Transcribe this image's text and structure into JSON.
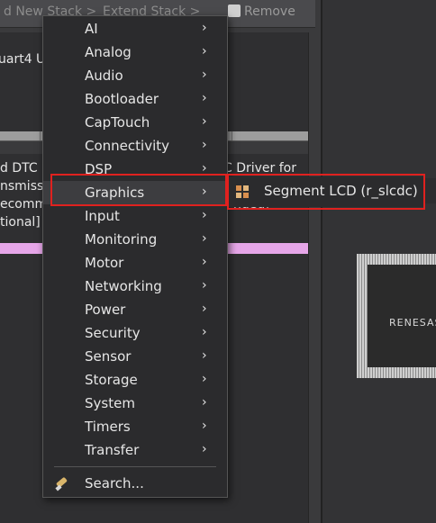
{
  "toolbar": {
    "new_stack": "d New Stack >",
    "extend_stack": "Extend Stack >",
    "remove": "Remove"
  },
  "panel": {
    "uart_label": "uart4 U",
    "lines": [
      "d DTC",
      "nsmiss",
      "ecomm",
      "tional]"
    ],
    "right_text_1": "C Driver for",
    "right_text_2": "nded)"
  },
  "menu": {
    "items": [
      {
        "label": "AI",
        "arrow": "›"
      },
      {
        "label": "Analog",
        "arrow": "›"
      },
      {
        "label": "Audio",
        "arrow": "›"
      },
      {
        "label": "Bootloader",
        "arrow": "›"
      },
      {
        "label": "CapTouch",
        "arrow": "›"
      },
      {
        "label": "Connectivity",
        "arrow": "›"
      },
      {
        "label": "DSP",
        "arrow": "›"
      },
      {
        "label": "Graphics",
        "arrow": "›"
      },
      {
        "label": "Input",
        "arrow": "›"
      },
      {
        "label": "Monitoring",
        "arrow": "›"
      },
      {
        "label": "Motor",
        "arrow": "›"
      },
      {
        "label": "Networking",
        "arrow": "›"
      },
      {
        "label": "Power",
        "arrow": "›"
      },
      {
        "label": "Security",
        "arrow": "›"
      },
      {
        "label": "Sensor",
        "arrow": "›"
      },
      {
        "label": "Storage",
        "arrow": "›"
      },
      {
        "label": "System",
        "arrow": "›"
      },
      {
        "label": "Timers",
        "arrow": "›"
      },
      {
        "label": "Transfer",
        "arrow": "›"
      }
    ],
    "search": "Search..."
  },
  "submenu": {
    "item": "Segment LCD (r_slcdc)"
  },
  "chip": {
    "logo": "RENESAS"
  }
}
